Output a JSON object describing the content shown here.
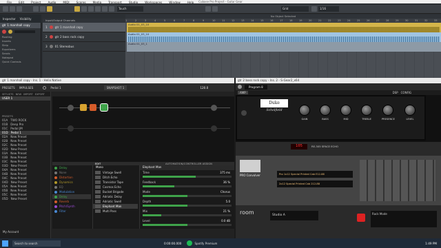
{
  "cubase": {
    "window_title": "Cubase Pro Project - Gutar Gear",
    "menu": [
      "File",
      "Edit",
      "Project",
      "Audio",
      "MIDI",
      "Scores",
      "Media",
      "Transport",
      "Studio",
      "Workspaces",
      "Window",
      "Help"
    ],
    "touch_mode": "Touch",
    "grid_mode": "Grid",
    "quantize": "1/16",
    "status": "No Object Selected",
    "inspector_tabs": [
      "Inspector",
      "Visibility"
    ],
    "inspector_track": "gtr 1 marshall copy",
    "inspector_items": [
      "Routing",
      "Inserts",
      "Strip",
      "Equalizers",
      "Sends",
      "Notepad",
      "Quick Controls"
    ],
    "folder_label": "Input/Output Channels",
    "tracks": [
      {
        "num": "1",
        "name": "gtr 1 marshall copy"
      },
      {
        "num": "2",
        "name": "gtr 2 bass rock copy"
      },
      {
        "num": "3",
        "name": "01 Stereobus"
      }
    ],
    "ruler": [
      "1",
      "2",
      "3",
      "4",
      "5",
      "6",
      "7",
      "8",
      "9",
      "10",
      "11",
      "12",
      "13",
      "14",
      "15",
      "16",
      "17",
      "18",
      "19",
      "20",
      "21",
      "22",
      "23",
      "24",
      "25",
      "26",
      "27",
      "28",
      "29",
      "30",
      "31",
      "32",
      "33"
    ],
    "clips": [
      "Audio 01_03_10",
      "Audio 01_03_10",
      "Audio 01_03_1"
    ]
  },
  "helix": {
    "title": "gtr 1 marshall copy - Ins. 1 - Helix Native",
    "preset_tabs": [
      "PRESETS",
      "IMPULSES"
    ],
    "list_label": "SETLISTS",
    "list_buttons": [
      "NEW",
      "IMPORT",
      "EXPORT"
    ],
    "user_bank": "USER 1",
    "presets_label": "PRESETS",
    "presets": [
      {
        "id": "01A",
        "name": "TWO ROCK"
      },
      {
        "id": "01B",
        "name": "Deep Pro"
      },
      {
        "id": "01C",
        "name": "Pedal JM"
      },
      {
        "id": "01D",
        "name": "Pedal 1"
      },
      {
        "id": "02A",
        "name": "New Preset"
      },
      {
        "id": "02B",
        "name": "New Preset"
      },
      {
        "id": "02C",
        "name": "New Preset"
      },
      {
        "id": "02D",
        "name": "New Preset"
      },
      {
        "id": "03A",
        "name": "New Preset"
      },
      {
        "id": "03B",
        "name": "New Preset"
      },
      {
        "id": "03C",
        "name": "New Preset"
      },
      {
        "id": "03D",
        "name": "New Preset"
      },
      {
        "id": "04A",
        "name": "New Preset"
      },
      {
        "id": "04B",
        "name": "New Preset"
      },
      {
        "id": "04C",
        "name": "New Preset"
      },
      {
        "id": "04D",
        "name": "New Preset"
      },
      {
        "id": "05A",
        "name": "New Preset"
      },
      {
        "id": "05B",
        "name": "New Preset"
      },
      {
        "id": "05C",
        "name": "New Preset"
      },
      {
        "id": "05D",
        "name": "New Preset"
      }
    ],
    "preset_name": "Pedal 1",
    "snapshot": "SNAPSHOT 1",
    "tempo": "120.0",
    "edit_tab": "EDIT",
    "auto_tab": "AUTOMATION/CONTROLLER ASSIGN",
    "categories": [
      "Delay",
      "None",
      "Distortion",
      "Dynamics",
      "EQ",
      "Modulation",
      "Delay",
      "Reverb",
      "Pitch/Synth",
      "Filter"
    ],
    "mode": "Mono",
    "effects": [
      "Vintage Swell",
      "Ditch Echo",
      "Transistor Tape",
      "Cosmos Echo",
      "Bucket Brigade",
      "Adriatic Delay",
      "Adriatic Swell",
      "Elephant Man",
      "Multi Pass"
    ],
    "selected_effect": "Elephant Man",
    "params": [
      {
        "name": "Time",
        "value": "375 ms",
        "level": 0.6
      },
      {
        "name": "Feedback",
        "value": "36 %",
        "level": 0.36
      },
      {
        "name": "Mode",
        "value": "Chorus",
        "level": 0.5
      },
      {
        "name": "Depth",
        "value": "5.0",
        "level": 0.5
      },
      {
        "name": "Mix",
        "value": "21 %",
        "level": 0.21
      },
      {
        "name": "Level",
        "value": "0.0 dB",
        "level": 0.5
      }
    ],
    "my_account": "My Account"
  },
  "amp": {
    "title": "gtr 2 bass rock copy - Ins. 2 - S-Gear2_x64",
    "program": "Program 8",
    "knobs": [
      "GAIN",
      "BASS",
      "MID",
      "TREBLE",
      "PRESENCE",
      "LEVEL"
    ],
    "brand": "Duke",
    "model_script": "Scholfield",
    "tabs": [
      "AMP",
      "DSP",
      "CONFIG"
    ],
    "reverb_label": "RE-305 SPACE ECHO",
    "reverb_value": "105",
    "cab_label": "PRO Convolver",
    "cab_rows": [
      "Pro 1x12 Special Printed Cab E12-88",
      "2x12 Special Printed Cab 212-88"
    ],
    "room_label": "room",
    "room_value": "Studio A",
    "rack_label": "Rack Mode"
  },
  "taskbar": {
    "start": "Start",
    "search": "Search to search",
    "time": "0:00:00.000",
    "spotify": "Spotify Premium",
    "clock": "1:49 PM"
  }
}
